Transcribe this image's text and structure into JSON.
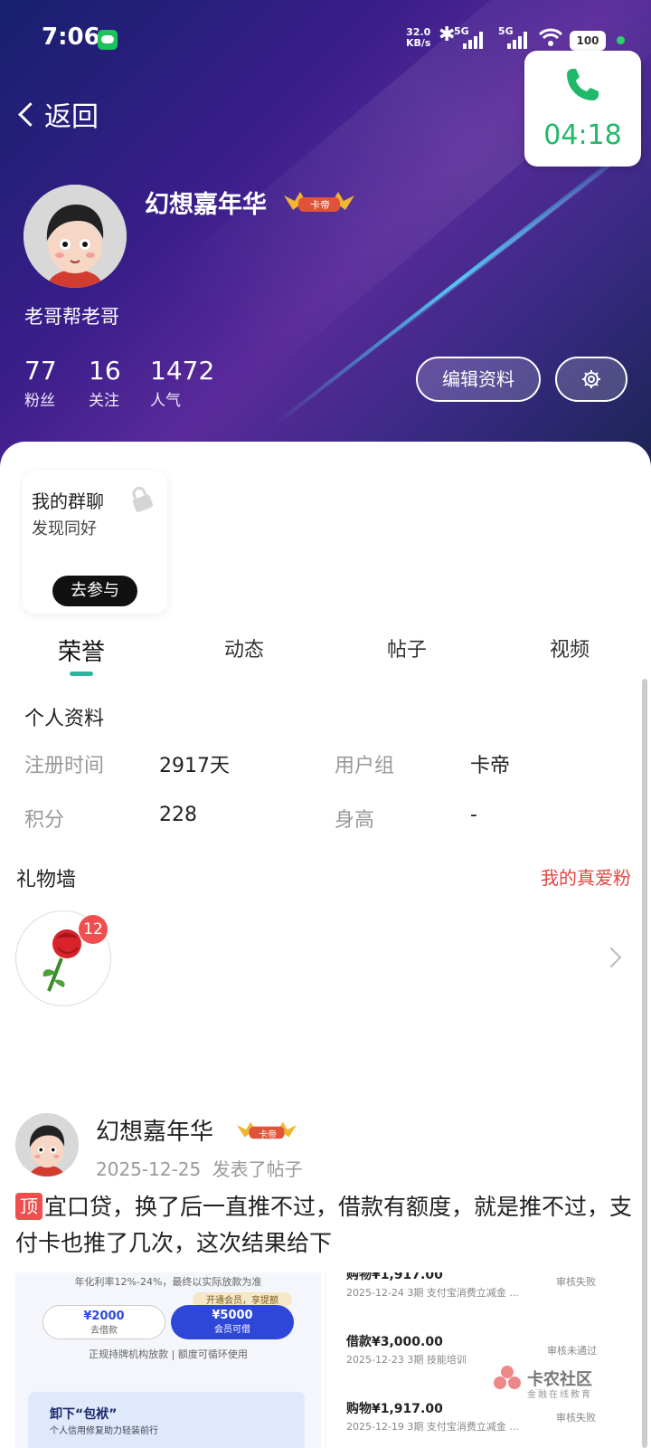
{
  "status_bar": {
    "time": "7:06",
    "net_speed": "32.0",
    "net_unit": "KB/s",
    "sig1": "5G",
    "sig2": "5G",
    "battery": "100"
  },
  "call": {
    "timer": "04:18"
  },
  "header": {
    "back_label": "返回"
  },
  "profile": {
    "name": "幻想嘉年华",
    "badge": "卡帝",
    "signature": "老哥帮老哥",
    "stats": [
      {
        "value": "77",
        "label": "粉丝"
      },
      {
        "value": "16",
        "label": "关注"
      },
      {
        "value": "1472",
        "label": "人气"
      }
    ],
    "edit_label": "编辑资料"
  },
  "group_card": {
    "title": "我的群聊",
    "subtitle": "发现同好",
    "join_label": "去参与"
  },
  "tabs": [
    "荣誉",
    "动态",
    "帖子",
    "视频"
  ],
  "personal_info": {
    "title": "个人资料",
    "rows": [
      {
        "label": "注册时间",
        "value": "2917天"
      },
      {
        "label": "用户组",
        "value": "卡帝"
      },
      {
        "label": "积分",
        "value": "228"
      },
      {
        "label": "身高",
        "value": "-"
      }
    ]
  },
  "gift_wall": {
    "title": "礼物墙",
    "link": "我的真爱粉",
    "gift_count": "12"
  },
  "post": {
    "author": "幻想嘉年华",
    "badge": "卡帝",
    "date": "2025-12-25",
    "action": "发表了帖子",
    "top_tag": "顶",
    "text": "宜口贷，换了后一直推不过，借款有额度，就是推不过，支付卡也推了几次，这次结果给下",
    "image1": {
      "rate": "年化利率12%-24%，最终以实际放款为准",
      "vip": "开通会员，享提额",
      "left_amount": "¥2000",
      "left_sub": "去借款",
      "right_amount": "¥5000",
      "right_sub": "会员可借",
      "note": "正规持牌机构放款  |  额度可循环使用",
      "banner_title": "卸下“包袱”",
      "banner_sub": "个人信用修复助力轻装前行"
    },
    "image2": {
      "records": [
        {
          "amount": "购物¥1,917.00",
          "date": "2025-12-24 3期  支付宝消费立减金 ...",
          "status": "审核失败"
        },
        {
          "amount": "借款¥3,000.00",
          "date": "2025-12-23 3期  技能培训",
          "status": "审核未通过"
        },
        {
          "amount": "购物¥1,917.00",
          "date": "2025-12-19 3期  支付宝消费立减金 ...",
          "status": "审核失败"
        }
      ],
      "watermark_title": "卡农社区",
      "watermark_sub": "金融在线教育"
    }
  },
  "colors": {
    "accent": "#2bb6a0",
    "call_green": "#21b86a",
    "red": "#e2473f"
  }
}
